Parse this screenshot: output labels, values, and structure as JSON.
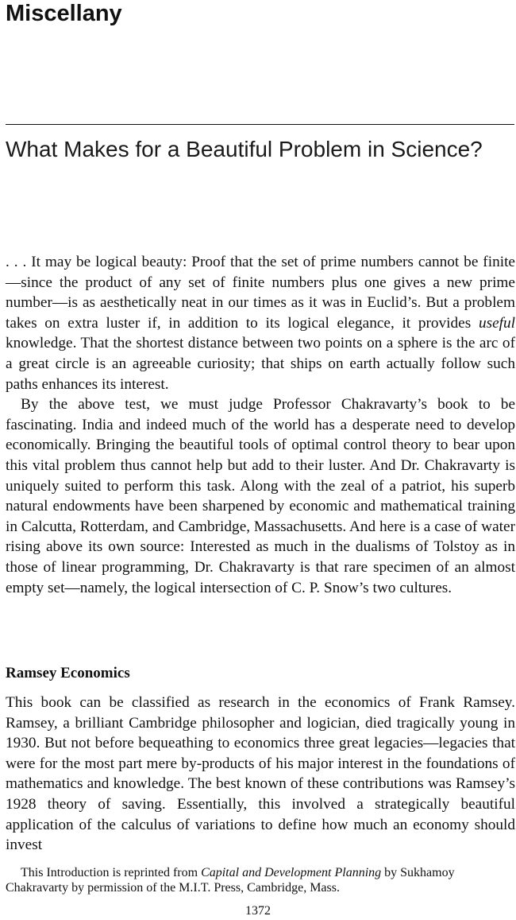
{
  "section": {
    "title": "Miscellany"
  },
  "article": {
    "title": "What Makes for a Beautiful Problem in Science?"
  },
  "body": {
    "p1": {
      "before": ". . . It may be logical beauty: Proof that the set of prime numbers cannot be finite—since the product of any set of finite numbers plus one gives a new prime number—is as aesthetically neat in our times as it was in Euclid’s. But a problem takes on extra luster if, in addition to its logical elegance, it provides ",
      "emphasis": "useful",
      "after": " knowledge. That the shortest distance between two points on a sphere is the arc of a great circle is an agreeable curiosity; that ships on earth actually follow such paths enhances its interest."
    },
    "p2": "By the above test, we must judge Professor Chakravarty’s book to be fascinating. India and indeed much of the world has a desperate need to develop economically. Bringing the beautiful tools of optimal control theory to bear upon this vital problem thus cannot help but add to their luster. And Dr. Chakravarty is uniquely suited to perform this task. Along with the zeal of a patriot, his superb natural endowments have been sharpened by economic and mathematical training in Calcutta, Rotterdam, and Cambridge, Massachusetts. And here is a case of water rising above its own source: Interested as much in the dualisms of Tolstoy as in those of linear programming, Dr. Chakravarty is that rare specimen of an almost empty set—namely, the logical intersection of C. P. Snow’s two cultures.",
    "subhead": "Ramsey Economics",
    "p3": "This book can be classified as research in the economics of Frank Ramsey. Ramsey, a brilliant Cambridge philosopher and logician, died tragically young in 1930. But not before bequeathing to economics three great legacies—legacies that were for the most part mere by-products of his major interest in the foundations of mathematics and knowledge. The best known of these contributions was Ramsey’s 1928 theory of saving. Essentially, this involved a strategically beautiful application of the calculus of variations to define how much an economy should invest"
  },
  "footnote": {
    "before": "This Introduction is reprinted from ",
    "book_title": "Capital and Development Planning",
    "after": " by Sukhamoy Chakravarty by permission of the M.I.T. Press, Cambridge, Mass."
  },
  "page_number": "1372"
}
